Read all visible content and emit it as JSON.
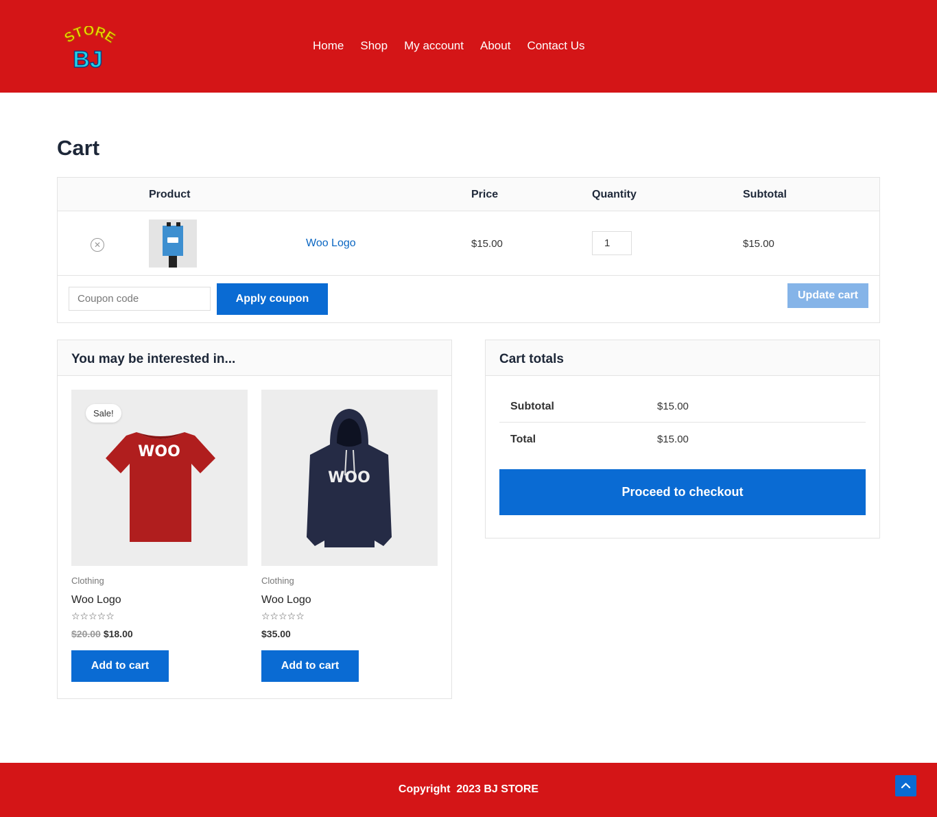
{
  "brand": {
    "logo_top_text": "STORE",
    "logo_bottom_text": "BJ"
  },
  "nav": {
    "items": [
      "Home",
      "Shop",
      "My account",
      "About",
      "Contact Us"
    ]
  },
  "page": {
    "title": "Cart"
  },
  "cart": {
    "headers": {
      "product": "Product",
      "price": "Price",
      "quantity": "Quantity",
      "subtotal": "Subtotal"
    },
    "items": [
      {
        "name": "Woo Logo",
        "price": "$15.00",
        "quantity": "1",
        "subtotal": "$15.00",
        "remove_icon": "close-circle-icon"
      }
    ],
    "coupon_placeholder": "Coupon code",
    "apply_coupon_label": "Apply coupon",
    "update_cart_label": "Update cart"
  },
  "cross_sells": {
    "title": "You may be interested in...",
    "products": [
      {
        "badge": "Sale!",
        "category": "Clothing",
        "name": "Woo Logo",
        "old_price": "$20.00",
        "price": "$18.00",
        "rating_stars": "☆☆☆☆☆",
        "button_label": "Add to cart",
        "image": "red-tshirt"
      },
      {
        "category": "Clothing",
        "name": "Woo Logo",
        "price": "$35.00",
        "rating_stars": "☆☆☆☆☆",
        "button_label": "Add to cart",
        "image": "navy-hoodie"
      }
    ]
  },
  "totals": {
    "title": "Cart totals",
    "subtotal_label": "Subtotal",
    "subtotal_value": "$15.00",
    "total_label": "Total",
    "total_value": "$15.00",
    "checkout_label": "Proceed to checkout"
  },
  "footer": {
    "copyright": "Copyright  2023 BJ STORE"
  },
  "colors": {
    "brand_red": "#d41517",
    "accent_blue": "#0a6bd3",
    "disabled_blue": "#85b4e8",
    "link_blue": "#0a66c2"
  }
}
